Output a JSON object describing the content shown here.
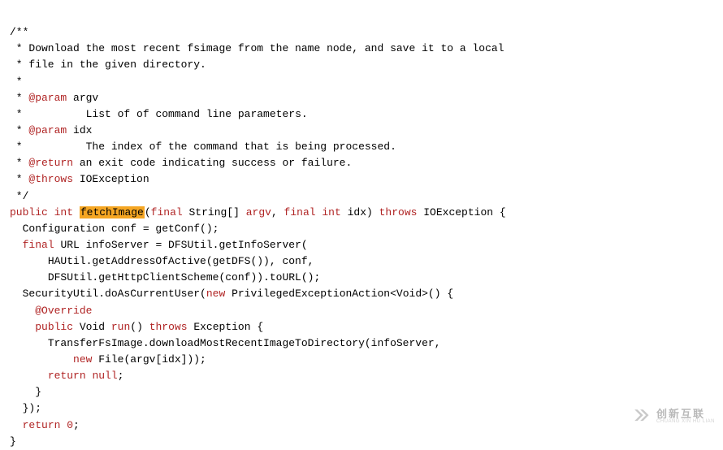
{
  "code": {
    "l1": "/**",
    "l2": "Download the most recent fsimage from the name node, and save it to a local",
    "l3": "file in the given directory.",
    "l4": " *",
    "l5a": "@param",
    "l5b": "argv",
    "l6": "List of of command line parameters.",
    "l7a": "@param",
    "l7b": "idx",
    "l8": "The index of the command that is being processed.",
    "l9a": "@return",
    "l9b": "an exit code indicating success or failure.",
    "l10a": "@throws",
    "l10b": "IOException",
    "l11": " */",
    "l12a": "public",
    "l12b": "int",
    "l12c": "fetchImage",
    "l12d": "final",
    "l12e": "String",
    "l12f": "argv",
    "l12g": "final",
    "l12h": "int",
    "l12i": "idx",
    "l12j": "throws",
    "l12k": "IOException",
    "l13": "Configuration conf = getConf();",
    "l14a": "final",
    "l14b": "URL infoServer = DFSUtil.getInfoServer(",
    "l15": "HAUtil.getAddressOfActive(getDFS()), conf,",
    "l16": "DFSUtil.getHttpClientScheme(conf)).toURL();",
    "l17a": "SecurityUtil.doAsCurrentUser(",
    "l17b": "new",
    "l17c": "PrivilegedExceptionAction<Void>() {",
    "l18": "@Override",
    "l19a": "public",
    "l19b": "Void",
    "l19c": "run",
    "l19d": "throws",
    "l19e": "Exception",
    "l20": "TransferFsImage.downloadMostRecentImageToDirectory(infoServer,",
    "l21a": "new",
    "l21b": "File(argv[idx]));",
    "l22a": "return",
    "l22b": "null",
    "l23": "}",
    "l24": "});",
    "l25a": "return",
    "l25b": "0",
    "l26": "}"
  },
  "watermark": {
    "zh": "创新互联",
    "en": "CHUANG XIN HU LIAN"
  }
}
